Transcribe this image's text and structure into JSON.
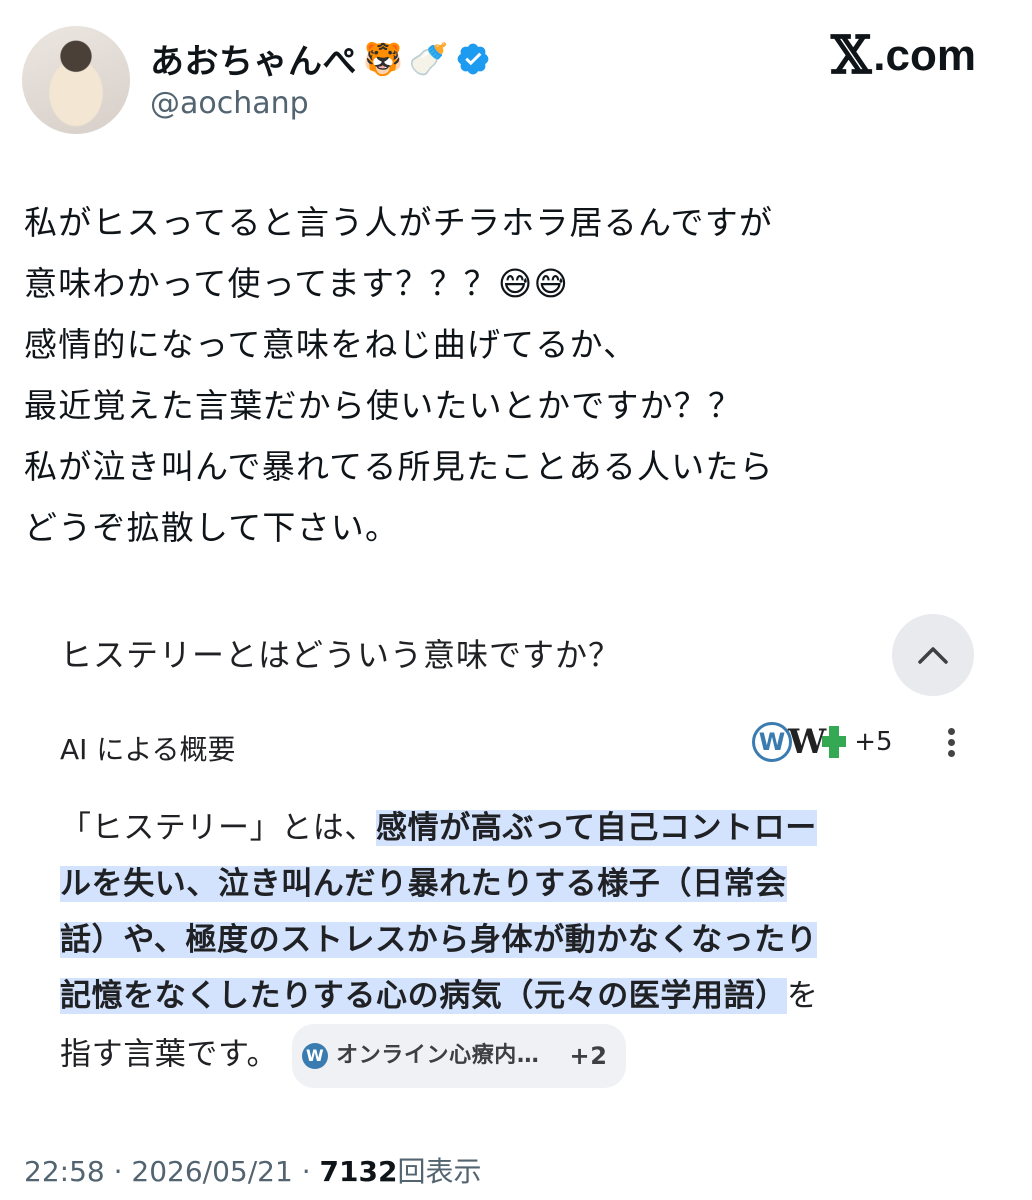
{
  "header": {
    "display_name": "あおちゃんぺ",
    "emojis": [
      "🐯",
      "🍼"
    ],
    "handle": "@aochanp",
    "site_logo": "𝕏",
    "site_domain": ".com"
  },
  "tweet_lines": [
    "私がヒスってると言う人がチラホラ居るんですが",
    "意味わかって使ってます？？？😅😅",
    "感情的になって意味をねじ曲げてるか、",
    "最近覚えた言葉だから使いたいとかですか？？",
    "私が泣き叫んで暴れてる所見たことある人いたら",
    "どうぞ拡散して下さい。"
  ],
  "embed": {
    "question": "ヒステリーとはどういう意味ですか？",
    "ai_label": "AI による概要",
    "source_count": "+5",
    "answer": {
      "line1_plain": "「ヒステリー」とは、",
      "line1_hl": "感情が高ぶって自己コントロー",
      "line2_hl": "ルを失い、泣き叫んだり暴れたりする様子（日常会",
      "line3_hl": "話）や、極度のストレスから身体が動かなくなったり",
      "line4_hl": "記憶をなくしたりする心の病気（元々の医学用語）",
      "line4_plain": "を",
      "line5_plain": "指す言葉です。"
    },
    "chip": {
      "label": "オンライン心療内…",
      "count": "+2"
    }
  },
  "meta": {
    "time": "22:58",
    "date": "2026/05/21",
    "views": "7132",
    "views_label": "回表示"
  },
  "colors": {
    "verified": "#1d9bf0",
    "highlight": "#d3e3fd"
  }
}
